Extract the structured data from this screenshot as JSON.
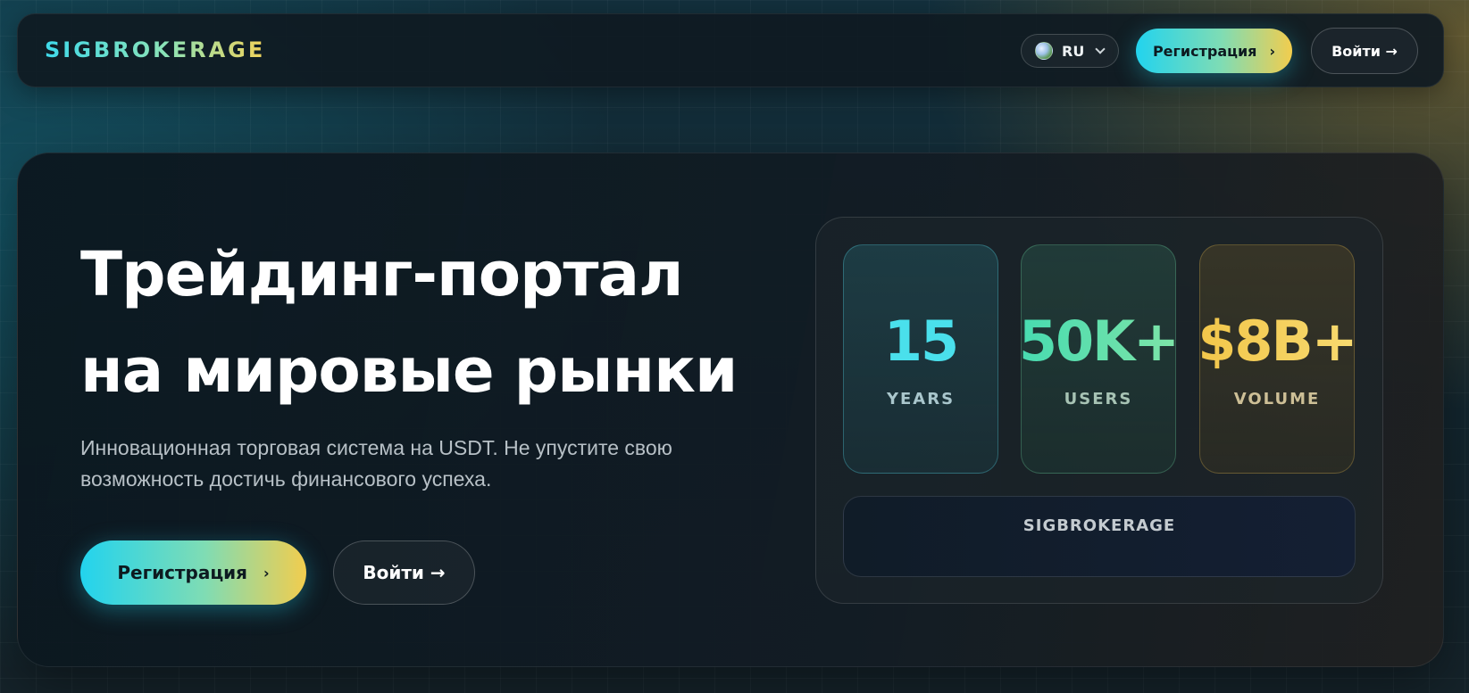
{
  "nav": {
    "logo": "SIGBROKERAGE",
    "language": "RU",
    "register_label": "Регистрация",
    "register_caret": "›",
    "login_label": "Войти →"
  },
  "hero": {
    "title_line1": "Трейдинг-портал",
    "title_line2": "на мировые рынки",
    "subtitle": "Инновационная торговая система на USDT. Не упустите свою возможность достичь финансового успеха.",
    "register_label": "Регистрация",
    "register_caret": "›",
    "login_label": "Войти →"
  },
  "stats": [
    {
      "value": "15",
      "label": "YEARS"
    },
    {
      "value": "50K+",
      "label": "USERS"
    },
    {
      "value": "$8B+",
      "label": "VOLUME"
    }
  ],
  "brand_box": {
    "text": "SIGBROKERAGE"
  },
  "colors": {
    "accent_cyan": "#22d3ee",
    "accent_green": "#7fdcb4",
    "accent_gold": "#f2cd4e"
  },
  "icons": {
    "language": "globe-icon",
    "dropdown": "chevron-down-icon",
    "arrow": "arrow-right-icon"
  }
}
